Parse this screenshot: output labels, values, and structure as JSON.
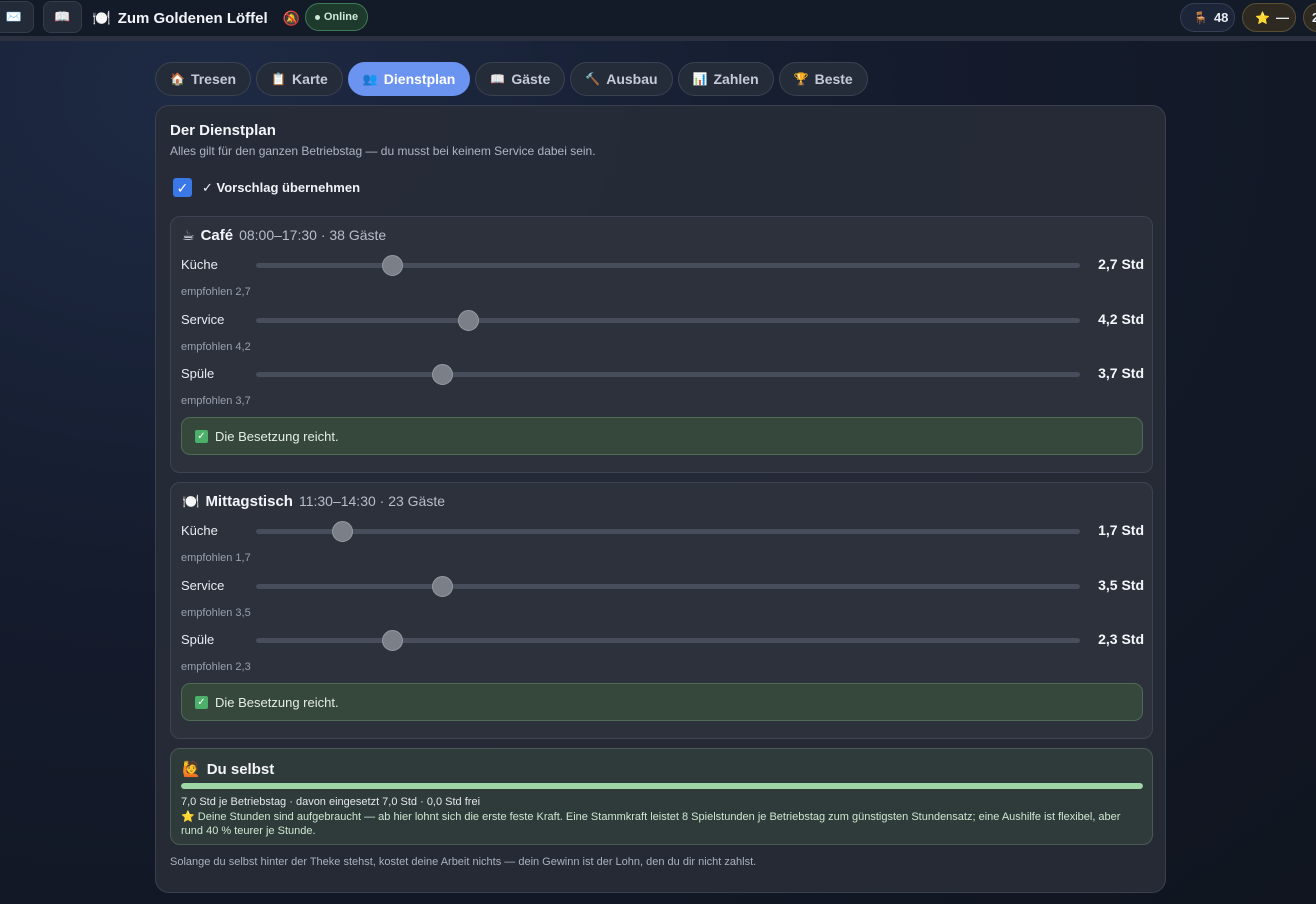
{
  "topbar": {
    "mail_icon": "✉️",
    "book_icon": "📖",
    "brand_icon": "🍽️",
    "title": "Zum Goldenen Löffel",
    "mute_icon": "🔕",
    "status": "Online",
    "seats_icon": "🪑",
    "seats": "48",
    "rating_icon": "⭐",
    "rating": "—",
    "edge_value": "2"
  },
  "tabs": [
    {
      "icon": "🏠",
      "label": "Tresen"
    },
    {
      "icon": "📋",
      "label": "Karte"
    },
    {
      "icon": "👥",
      "label": "Dienstplan",
      "active": true
    },
    {
      "icon": "📖",
      "label": "Gäste"
    },
    {
      "icon": "🔨",
      "label": "Ausbau"
    },
    {
      "icon": "📊",
      "label": "Zahlen"
    },
    {
      "icon": "🏆",
      "label": "Beste"
    }
  ],
  "panel": {
    "title": "Der Dienstplan",
    "subtitle": "Alles gilt für den ganzen Betriebstag — du musst bei keinem Service dabei sein.",
    "suggestion_label": "✓ Vorschlag übernehmen",
    "suggestion_checked": true
  },
  "sections": [
    {
      "icon": "☕",
      "name": "Café",
      "meta": "08:00–17:30 · 38 Gäste",
      "rows": [
        {
          "label": "Küche",
          "value": "2,7 Std",
          "recommendation": "empfohlen 2,7",
          "level": 0.165
        },
        {
          "label": "Service",
          "value": "4,2 Std",
          "recommendation": "empfohlen 4,2",
          "level": 0.257
        },
        {
          "label": "Spüle",
          "value": "3,7 Std",
          "recommendation": "empfohlen 3,7",
          "level": 0.226
        }
      ],
      "status": "Die Besetzung reicht."
    },
    {
      "icon": "🍽️",
      "name": "Mittagstisch",
      "meta": "11:30–14:30 · 23 Gäste",
      "rows": [
        {
          "label": "Küche",
          "value": "1,7 Std",
          "recommendation": "empfohlen 1,7",
          "level": 0.104
        },
        {
          "label": "Service",
          "value": "3,5 Std",
          "recommendation": "empfohlen 3,5",
          "level": 0.226
        },
        {
          "label": "Spüle",
          "value": "2,3 Std",
          "recommendation": "empfohlen 2,3",
          "level": 0.165
        }
      ],
      "status": "Die Besetzung reicht."
    }
  ],
  "self": {
    "icon": "🙋",
    "title": "Du selbst",
    "progress": 1.0,
    "summary": "7,0 Std je Betriebstag · davon eingesetzt 7,0 Std · 0,0 Std frei",
    "note": "⭐ Deine Stunden sind aufgebraucht — ab hier lohnt sich die erste feste Kraft. Eine Stammkraft leistet 8 Spielstunden je Betriebstag zum günstigsten Stundensatz; eine Aushilfe ist flexibel, aber rund 40 % teurer je Stunde."
  },
  "footnote": "Solange du selbst hinter der Theke stehst, kostet deine Arbeit nichts — dein Gewinn ist der Lohn, den du dir nicht zahlst.",
  "colors": {
    "accent": "#6b93f0",
    "checkbox": "#3b78e7",
    "ok_box": "#36483c",
    "progress": "#9fd6a6"
  }
}
